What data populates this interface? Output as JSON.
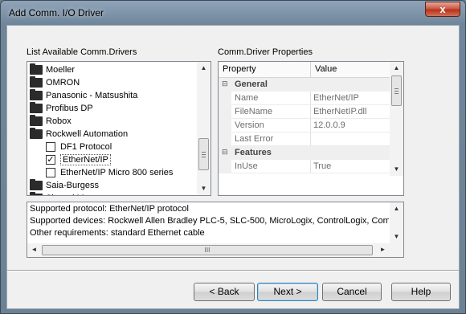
{
  "window": {
    "title": "Add Comm. I/O Driver",
    "close_glyph": "x"
  },
  "driver_list": {
    "label": "List Available Comm.Drivers",
    "items": [
      {
        "type": "folder",
        "label": "Moeller"
      },
      {
        "type": "folder",
        "label": "OMRON"
      },
      {
        "type": "folder",
        "label": "Panasonic - Matsushita"
      },
      {
        "type": "folder",
        "label": "Profibus DP"
      },
      {
        "type": "folder",
        "label": "Robox"
      },
      {
        "type": "folder",
        "label": "Rockwell Automation"
      },
      {
        "type": "driver",
        "label": "DF1 Protocol",
        "checked": false
      },
      {
        "type": "driver",
        "label": "EtherNet/IP",
        "checked": true,
        "selected": true
      },
      {
        "type": "driver",
        "label": "EtherNet/IP Micro 800 series",
        "checked": false
      },
      {
        "type": "folder",
        "label": "Saia-Burgess"
      },
      {
        "type": "folder",
        "label": "Shared Memory"
      }
    ],
    "checkmark_glyph": "✓",
    "scroll_up_glyph": "▲",
    "scroll_down_glyph": "▼"
  },
  "properties": {
    "label": "Comm.Driver Properties",
    "columns": [
      "Property",
      "Value"
    ],
    "categories": [
      {
        "name": "General",
        "expander": "⊟",
        "rows": [
          {
            "name": "Name",
            "value": "EtherNet/IP"
          },
          {
            "name": "FileName",
            "value": "EtherNetIP.dll"
          },
          {
            "name": "Version",
            "value": "12.0.0.9"
          },
          {
            "name": "Last Error",
            "value": ""
          }
        ]
      },
      {
        "name": "Features",
        "expander": "⊟",
        "rows": [
          {
            "name": "InUse",
            "value": "True"
          }
        ]
      }
    ]
  },
  "info": {
    "lines": [
      "Supported protocol: EtherNet/IP protocol",
      "Supported devices: Rockwell Allen Bradley PLC-5, SLC-500, MicroLogix, ControlLogix, Compact",
      "Other requirements: standard Ethernet cable"
    ],
    "scroll_left_glyph": "◄",
    "scroll_right_glyph": "►",
    "thumb_glyph": "III"
  },
  "buttons": {
    "back": "< Back",
    "next": "Next >",
    "cancel": "Cancel",
    "help": "Help"
  }
}
